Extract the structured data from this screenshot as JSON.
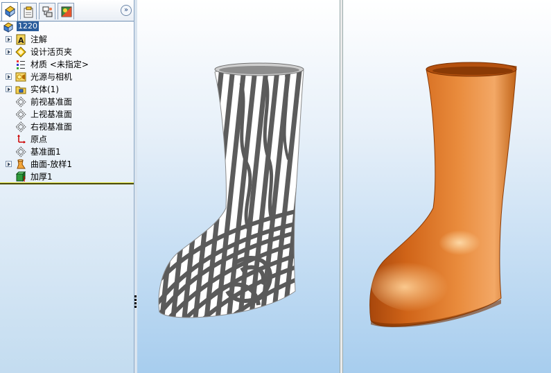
{
  "tabs": [
    {
      "name": "featuremanager-tab",
      "icon": "feature-tree-icon",
      "active": true
    },
    {
      "name": "propertymanager-tab",
      "icon": "property-manager-icon",
      "active": false
    },
    {
      "name": "configurationmanager-tab",
      "icon": "configuration-manager-icon",
      "active": false
    },
    {
      "name": "displaymanager-tab",
      "icon": "display-manager-icon",
      "active": false
    }
  ],
  "expand_button": "»",
  "tree": {
    "root": "1220",
    "items": [
      {
        "label": "注解",
        "icon": "annotations-icon",
        "expandable": true
      },
      {
        "label": "设计活页夹",
        "icon": "design-binder-icon",
        "expandable": true
      },
      {
        "label": "材质 <未指定>",
        "icon": "material-icon",
        "expandable": false
      },
      {
        "label": "光源与相机",
        "icon": "lights-cameras-icon",
        "expandable": true
      },
      {
        "label": "实体(1)",
        "icon": "solid-bodies-folder-icon",
        "expandable": true
      },
      {
        "label": "前视基准面",
        "icon": "plane-icon",
        "expandable": false
      },
      {
        "label": "上视基准面",
        "icon": "plane-icon",
        "expandable": false
      },
      {
        "label": "右视基准面",
        "icon": "plane-icon",
        "expandable": false
      },
      {
        "label": "原点",
        "icon": "origin-icon",
        "expandable": false
      },
      {
        "label": "基准面1",
        "icon": "plane-icon",
        "expandable": false
      },
      {
        "label": "曲面-放样1",
        "icon": "surface-loft-icon",
        "expandable": true
      },
      {
        "label": "加厚1",
        "icon": "thicken-icon",
        "expandable": false
      }
    ]
  },
  "viewports": {
    "left": {
      "display": "zebra-stripes",
      "model": "boot"
    },
    "right": {
      "display": "shaded",
      "model": "boot",
      "color": "#d9782a"
    }
  },
  "colors": {
    "selection": "#2b5d9c",
    "rollback_bar": "#4a4a00",
    "viewport_bottom": "#a7cdee",
    "boot_orange": "#d9782a"
  }
}
